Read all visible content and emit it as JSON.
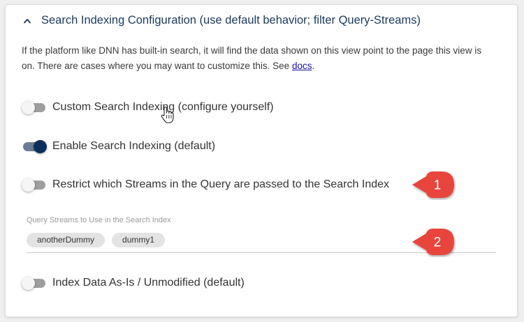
{
  "section": {
    "title": "Search Indexing Configuration (use default behavior; filter Query-Streams)",
    "description_text": "If the platform like DNN has built-in search, it will find the data shown on this view point to the page this view is on. There are cases where you may want to customize this. See ",
    "docs_link": "docs",
    "description_end": "."
  },
  "toggles": [
    {
      "label": "Custom Search Indexing (configure yourself)",
      "on": false
    },
    {
      "label": "Enable Search Indexing (default)",
      "on": true
    },
    {
      "label": "Restrict which Streams in the Query are passed to the Search Index",
      "on": false
    },
    {
      "label": "Index Data As-Is / Unmodified (default)",
      "on": false
    }
  ],
  "streams_field": {
    "label": "Query Streams to Use in the Search Index",
    "chips": [
      "anotherDummy",
      "dummy1"
    ]
  },
  "callouts": [
    "1",
    "2"
  ],
  "colors": {
    "accent": "#0b2f5a",
    "header_text": "#1a3a5c",
    "callout_red": "#e8453c",
    "link": "#1a0dab"
  },
  "icons": {
    "collapse": "chevron-up-icon",
    "pointer": "hand-cursor-icon"
  }
}
